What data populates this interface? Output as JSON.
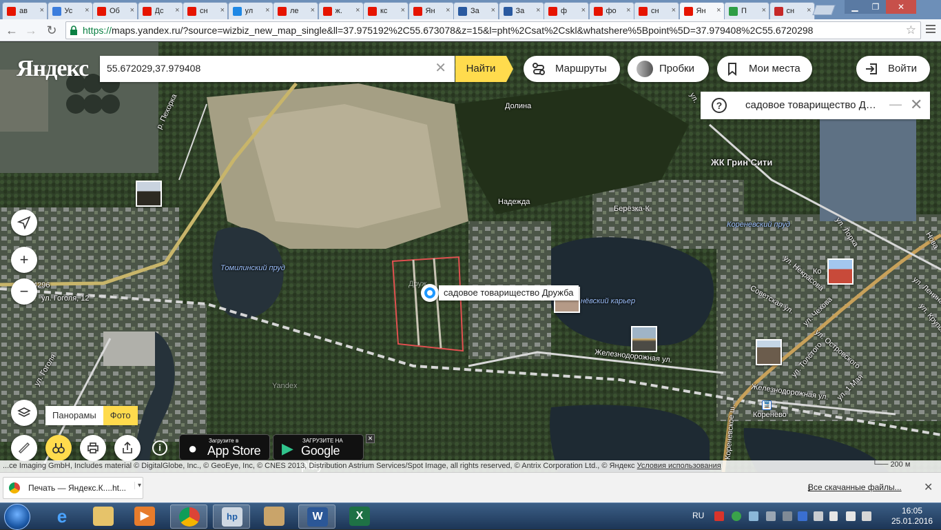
{
  "browser": {
    "tabs": [
      {
        "favicon": "yandex-icon",
        "color": "#e61400",
        "title": "ав"
      },
      {
        "favicon": "paw-icon",
        "color": "#3b7ddd",
        "title": "Ус"
      },
      {
        "favicon": "yandex-y-icon",
        "color": "#e61400",
        "title": "Об"
      },
      {
        "favicon": "yandex-y-icon",
        "color": "#e61400",
        "title": "Дс"
      },
      {
        "favicon": "yandex-icon",
        "color": "#e61400",
        "title": "сн"
      },
      {
        "favicon": "wave-icon",
        "color": "#1e88e5",
        "title": "ул"
      },
      {
        "favicon": "yandex-icon",
        "color": "#e61400",
        "title": "ле"
      },
      {
        "favicon": "yandex-icon",
        "color": "#e61400",
        "title": "ж."
      },
      {
        "favicon": "yandex-icon",
        "color": "#e61400",
        "title": "кс"
      },
      {
        "favicon": "map-pin-icon",
        "color": "#e61400",
        "title": "Ян"
      },
      {
        "favicon": "house-icon",
        "color": "#2a5aa0",
        "title": "За"
      },
      {
        "favicon": "house-icon",
        "color": "#2a5aa0",
        "title": "За"
      },
      {
        "favicon": "yandex-icon",
        "color": "#e61400",
        "title": "ф"
      },
      {
        "favicon": "yandex-icon",
        "color": "#e61400",
        "title": "фо"
      },
      {
        "favicon": "yandex-icon",
        "color": "#e61400",
        "title": "сн"
      },
      {
        "favicon": "map-pin-icon",
        "color": "#e61400",
        "title": "Ян",
        "active": true
      },
      {
        "favicon": "p-icon",
        "color": "#2e9e45",
        "title": "П"
      },
      {
        "favicon": "image-icon",
        "color": "#c62828",
        "title": "сн"
      }
    ],
    "url_scheme": "https://",
    "url_rest": "maps.yandex.ru/?source=wizbiz_new_map_single&ll=37.975192%2C55.673078&z=15&l=pht%2Csat%2Cskl&whatshere%5Bpoint%5D=37.979408%2C55.6720298"
  },
  "map": {
    "logo": "Яндекс",
    "search": {
      "value": "55.672029,37.979408",
      "button": "Найти"
    },
    "header_buttons": {
      "routes": "Маршруты",
      "traffic": "Пробки",
      "my_places": "Мои места",
      "login": "Войти"
    },
    "whatshere": {
      "text": "садовое товарищество Д…"
    },
    "pin_label": "садовое товарищество Дружба",
    "layer_tabs": {
      "panoramas": "Панорамы",
      "photo": "Фото"
    },
    "apps": {
      "appstore_small": "Загрузите в",
      "appstore_big": "App Store",
      "googleplay_small": "ЗАГРУЗИТЕ НА",
      "googleplay_big": "Google play"
    },
    "labels": {
      "dolina": "Долина",
      "green_city": "ЖК Грин Сити",
      "nadezhda": "Надежда",
      "berezka": "Берёзка-К",
      "korenevsky_pond": "Кореневский пруд",
      "tomilinsky_pond": "Томилинский пруд",
      "karyer": "нёвский карьер",
      "druzhba_faint": "Друж",
      "zheleznodorozhnaya_1": "Железнодорожная ул.",
      "zheleznodorozhnaya_2": "Железнодорожная ул.",
      "korenevo": "Коренёво",
      "chekhova": "ул. Чехова",
      "ostrovskogo": "ул. Островского",
      "tolstogo": "ул. Толстого",
      "nekrasova": "ул. Некрасова",
      "lorka": "ул. Лорха",
      "sovetskaya": "Советская ул.",
      "gogolya": "ул. Гоголя",
      "gogolya_12": "ул. Гоголя, 12",
      "pekhorka": "р. Пехорка",
      "korenevskoe_sh": "Кореневское ш.",
      "yandex_watermark": "Yandex",
      "road_4296": "4296",
      "nova": "Нова",
      "lenina": "ул. Ленина",
      "krupskoi": "ул. Крупской",
      "maya": "ул. 1 Мая",
      "ulfragment": "ул.",
      "ko_fragment": "Ко"
    },
    "copyright": "...ce Imaging GmbH, Includes material © DigitalGlobe, Inc., © GeoEye, Inc, © CNES 2013, Distribution Astrium Services/Spot Image, all rights reserved, © Antrix Corporation Ltd., © Яндекс",
    "terms": "Условия использования",
    "scale": "200 м"
  },
  "downloads": {
    "item": "Печать — Яндекс.К....ht...",
    "show_all": "Все скачанные файлы..."
  },
  "taskbar": {
    "lang": "RU",
    "time": "16:05",
    "date": "25.01.2016"
  }
}
